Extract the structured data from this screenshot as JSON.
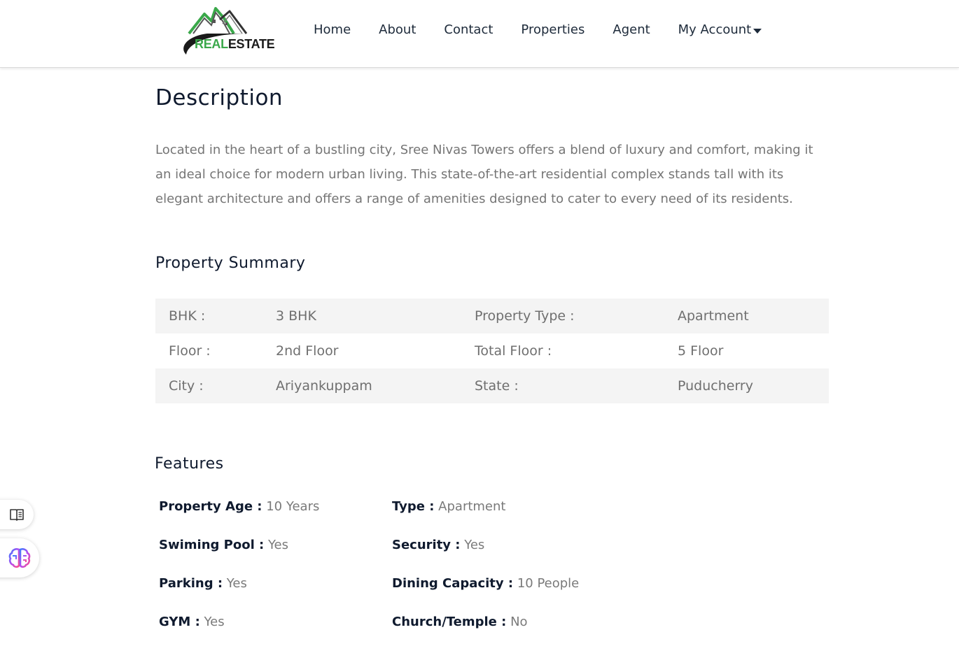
{
  "header": {
    "logo": {
      "text_real": "REAL",
      "text_estate": "ESTATE"
    },
    "nav": [
      {
        "label": "Home"
      },
      {
        "label": "About"
      },
      {
        "label": "Contact"
      },
      {
        "label": "Properties"
      },
      {
        "label": "Agent"
      },
      {
        "label": "My Account"
      }
    ]
  },
  "description": {
    "title": "Description",
    "text": "Located in the heart of a bustling city, Sree Nivas Towers offers a blend of luxury and comfort, making it an ideal choice for modern urban living. This state-of-the-art residential complex stands tall with its elegant architecture and offers a range of amenities designed to cater to every need of its residents."
  },
  "summary": {
    "title": "Property Summary",
    "rows": [
      {
        "k1": "BHK :",
        "v1": "3 BHK",
        "k2": "Property Type :",
        "v2": "Apartment"
      },
      {
        "k1": "Floor :",
        "v1": "2nd Floor",
        "k2": "Total Floor :",
        "v2": "5 Floor"
      },
      {
        "k1": "City :",
        "v1": "Ariyankuppam",
        "k2": "State :",
        "v2": "Puducherry"
      }
    ]
  },
  "features": {
    "title": "Features",
    "rows": [
      [
        {
          "k": "Property Age :",
          "v": "10 Years"
        },
        {
          "k": "Type :",
          "v": "Apartment"
        }
      ],
      [
        {
          "k": "Swiming Pool :",
          "v": "Yes"
        },
        {
          "k": "Security :",
          "v": "Yes"
        }
      ],
      [
        {
          "k": "Parking :",
          "v": "Yes"
        },
        {
          "k": "Dining Capacity :",
          "v": "10 People"
        }
      ],
      [
        {
          "k": "GYM :",
          "v": "Yes"
        },
        {
          "k": "Church/Temple :",
          "v": "No"
        }
      ]
    ]
  },
  "side_buttons": {
    "reader_icon": "book-reader-icon",
    "brain_icon": "brain-icon"
  },
  "colors": {
    "accent_green": "#3aa84a",
    "heading": "#0f1a2e",
    "body_text": "#757575",
    "table_shade": "#f4f4f4"
  }
}
